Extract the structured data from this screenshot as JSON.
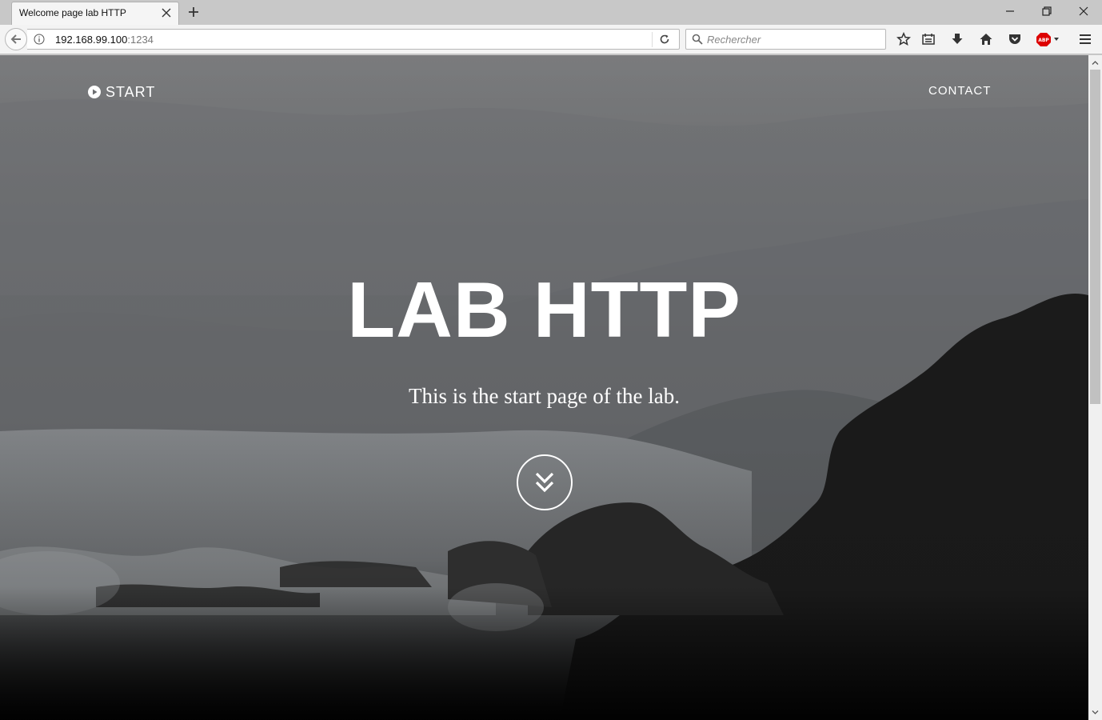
{
  "browser": {
    "tab_title": "Welcome page lab HTTP",
    "url_host": "192.168.99.100",
    "url_port": ":1234",
    "search_placeholder": "Rechercher"
  },
  "site": {
    "brand_label": "START",
    "nav_contact": "CONTACT",
    "hero_title": "LAB HTTP",
    "hero_subtitle": "This is the start page of the lab."
  }
}
